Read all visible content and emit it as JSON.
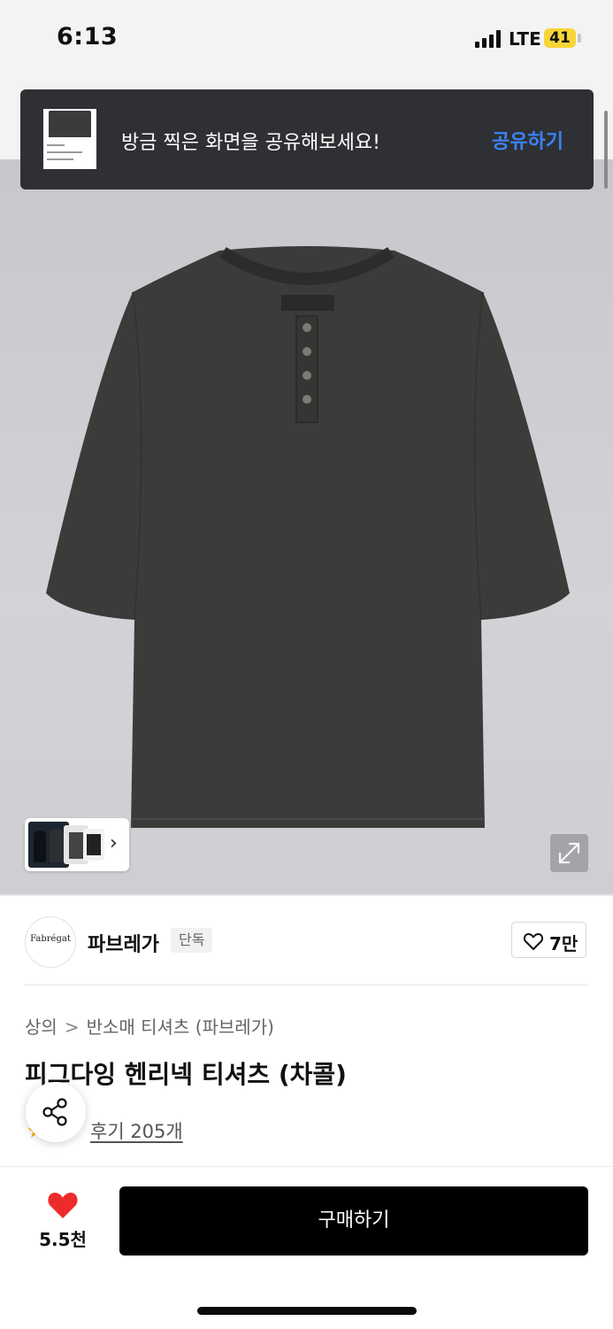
{
  "status_bar": {
    "time": "6:13",
    "network": "LTE",
    "battery": "41",
    "signal_icon": "signal-bars-icon"
  },
  "toast": {
    "message": "방금 찍은 화면을 공유해보세요!",
    "action_label": "공유하기",
    "action_color": "#3b82f6"
  },
  "gallery": {
    "thumbnails_icon": "chevron-right-icon",
    "expand_icon": "expand-arrows-icon"
  },
  "brand": {
    "logo_text": "Fabrégat",
    "name": "파브레가",
    "badge": "단독",
    "like_count": "7만"
  },
  "breadcrumb": {
    "items": [
      "상의",
      "반소매 티셔츠 (파브레가)"
    ],
    "separator": ">"
  },
  "product": {
    "title": "피그다잉 헨리넥 티셔츠 (차콜)",
    "review_link": "후기 205개",
    "rating_icon": "star-icon"
  },
  "bottom_bar": {
    "wish_count": "5.5천",
    "buy_label": "구매하기",
    "heart_color": "#ee2b2b"
  }
}
